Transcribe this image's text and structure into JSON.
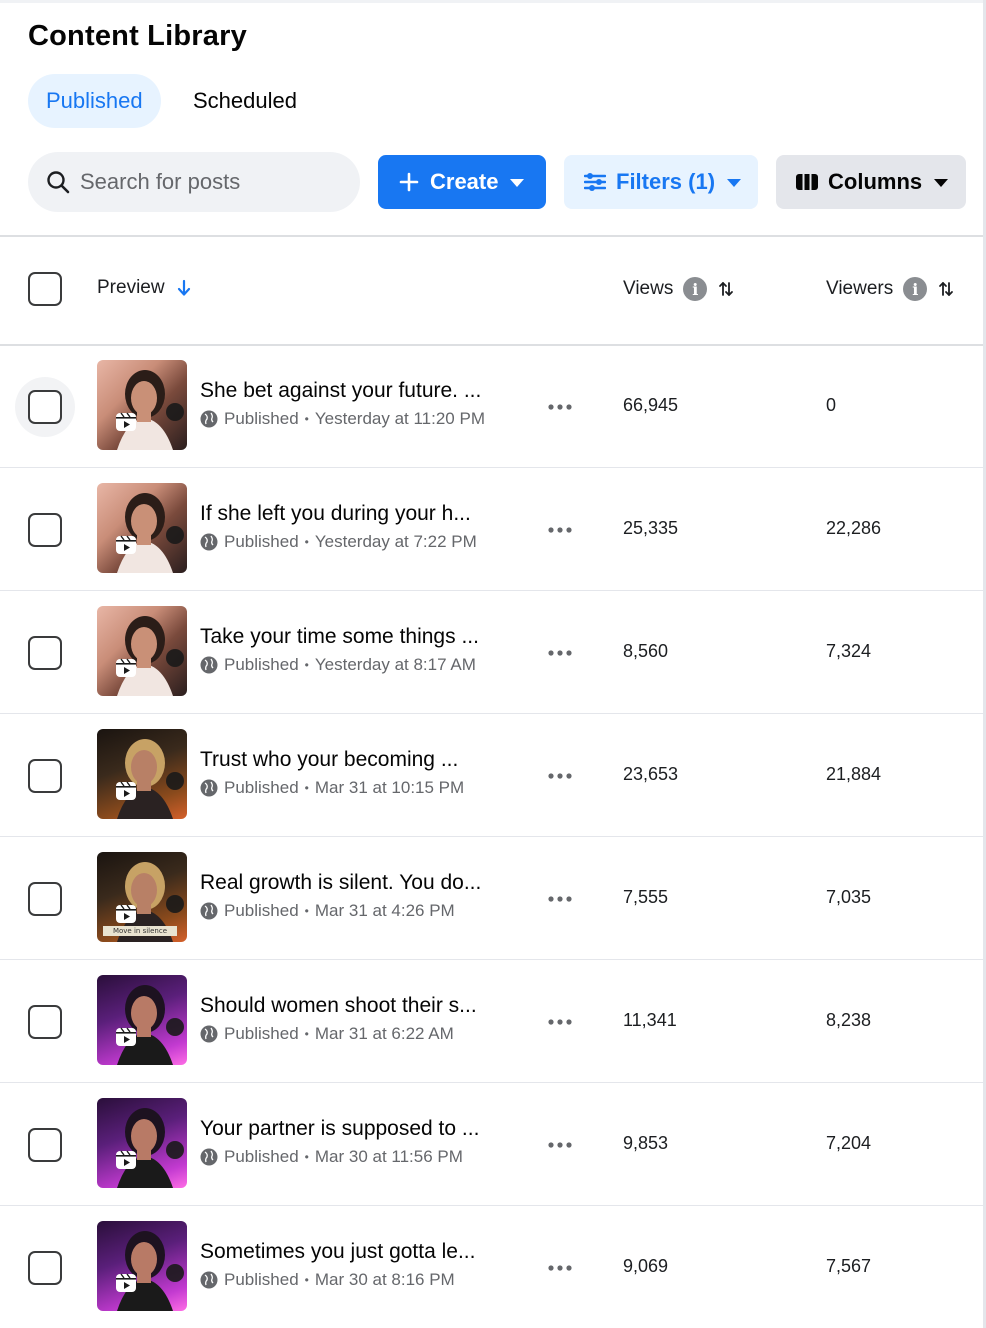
{
  "page": {
    "title": "Content Library"
  },
  "tabs": [
    {
      "label": "Published",
      "active": true
    },
    {
      "label": "Scheduled",
      "active": false
    }
  ],
  "toolbar": {
    "search_placeholder": "Search for posts",
    "search_icon": "search-icon",
    "create_label": "Create",
    "filters_label": "Filters (1)",
    "columns_label": "Columns"
  },
  "table": {
    "columns": {
      "preview": "Preview",
      "views": "Views",
      "viewers": "Viewers"
    },
    "rows": [
      {
        "title": "She bet against your future. ...",
        "status": "Published",
        "time": "Yesterday at 11:20 PM",
        "views": "66,945",
        "viewers": "0",
        "thumb": "pink-mic",
        "caption": ""
      },
      {
        "title": "If she left you during your h...",
        "status": "Published",
        "time": "Yesterday at 7:22 PM",
        "views": "25,335",
        "viewers": "22,286",
        "thumb": "pink-mic",
        "caption": ""
      },
      {
        "title": "Take your time some things ...",
        "status": "Published",
        "time": "Yesterday at 8:17 AM",
        "views": "8,560",
        "viewers": "7,324",
        "thumb": "pink-mic",
        "caption": ""
      },
      {
        "title": "Trust who your becoming ...",
        "status": "Published",
        "time": "Mar 31 at 10:15 PM",
        "views": "23,653",
        "viewers": "21,884",
        "thumb": "dark-orange",
        "caption": ""
      },
      {
        "title": "Real growth is silent. You do...",
        "status": "Published",
        "time": "Mar 31 at 4:26 PM",
        "views": "7,555",
        "viewers": "7,035",
        "thumb": "dark-orange",
        "caption": "Move in silence"
      },
      {
        "title": "Should women shoot their s...",
        "status": "Published",
        "time": "Mar 31 at 6:22 AM",
        "views": "11,341",
        "viewers": "8,238",
        "thumb": "purple-neon",
        "caption": ""
      },
      {
        "title": "Your partner is supposed to ...",
        "status": "Published",
        "time": "Mar 30 at 11:56 PM",
        "views": "9,853",
        "viewers": "7,204",
        "thumb": "purple-neon",
        "caption": ""
      },
      {
        "title": "Sometimes you just gotta le...",
        "status": "Published",
        "time": "Mar 30 at 8:16 PM",
        "views": "9,069",
        "viewers": "7,567",
        "thumb": "purple-neon",
        "caption": ""
      }
    ]
  },
  "colors": {
    "accent": "#1877f2",
    "accent_light": "#e7f3ff",
    "muted_text": "#65676b"
  }
}
